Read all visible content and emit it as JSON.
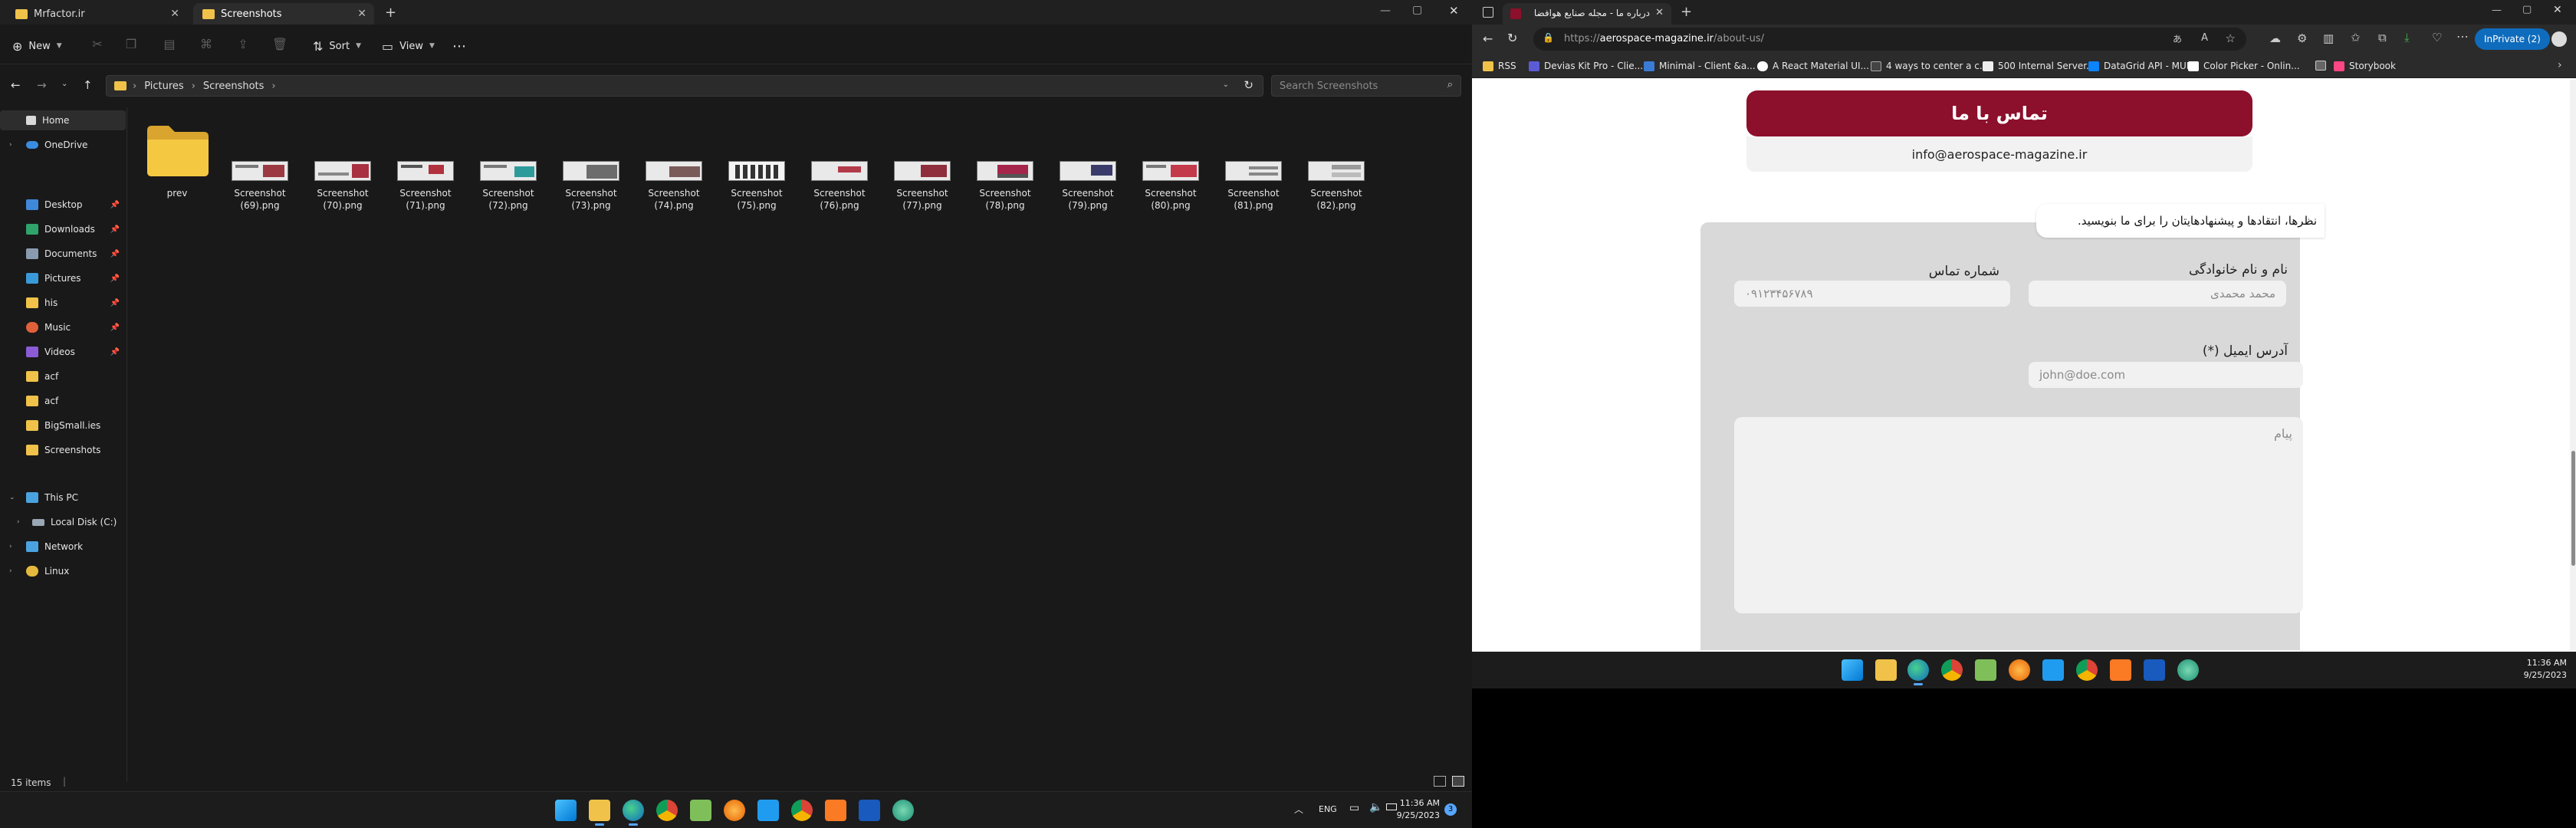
{
  "explorer": {
    "tabs": [
      {
        "label": "Mrfactor.ir"
      },
      {
        "label": "Screenshots"
      }
    ],
    "toolbar": {
      "new_label": "New",
      "sort_label": "Sort",
      "view_label": "View"
    },
    "breadcrumb": [
      "Pictures",
      "Screenshots"
    ],
    "search_placeholder": "Search Screenshots",
    "nav": {
      "home": "Home",
      "onedrive": "OneDrive",
      "quick": [
        "Desktop",
        "Downloads",
        "Documents",
        "Pictures",
        "his",
        "Music",
        "Videos",
        "acf",
        "acf",
        "BigSmall.ies",
        "Screenshots"
      ],
      "thispc": "This PC",
      "localdisk": "Local Disk (C:)",
      "network": "Network",
      "linux": "Linux"
    },
    "files": [
      {
        "l1": "prev",
        "l2": ""
      },
      {
        "l1": "Screenshot",
        "l2": "(69).png"
      },
      {
        "l1": "Screenshot",
        "l2": "(70).png"
      },
      {
        "l1": "Screenshot",
        "l2": "(71).png"
      },
      {
        "l1": "Screenshot",
        "l2": "(72).png"
      },
      {
        "l1": "Screenshot",
        "l2": "(73).png"
      },
      {
        "l1": "Screenshot",
        "l2": "(74).png"
      },
      {
        "l1": "Screenshot",
        "l2": "(75).png"
      },
      {
        "l1": "Screenshot",
        "l2": "(76).png"
      },
      {
        "l1": "Screenshot",
        "l2": "(77).png"
      },
      {
        "l1": "Screenshot",
        "l2": "(78).png"
      },
      {
        "l1": "Screenshot",
        "l2": "(79).png"
      },
      {
        "l1": "Screenshot",
        "l2": "(80).png"
      },
      {
        "l1": "Screenshot",
        "l2": "(81).png"
      },
      {
        "l1": "Screenshot",
        "l2": "(82).png"
      }
    ],
    "status": "15 items"
  },
  "edge": {
    "tab_title": "درباره ما - مجله صنایع هوافضا",
    "url_prefix": "https://",
    "url_host": "aerospace-magazine.ir",
    "url_path": "/about-us/",
    "inprivate": "InPrivate (2)",
    "favorites": [
      "RSS",
      "Devias Kit Pro - Clie...",
      "Minimal - Client &a...",
      "A React Material UI...",
      "4 ways to center a c...",
      "500 Internal Server...",
      "DataGrid API - MUI X",
      "Color Picker - Onlin...",
      "Storybook"
    ]
  },
  "webpage": {
    "contact_button": "تماس با ما",
    "email": "info@aerospace-magazine.ir",
    "intro": "نظرها، انتقادها و پیشنهادهایتان را برای ما بنویسید.",
    "name_label": "نام و نام خانوادگی",
    "name_placeholder": "محمد محمدی",
    "phone_label": "شماره تماس",
    "phone_placeholder": "۰۹۱۲۳۴۵۶۷۸۹",
    "email_label": "آدرس ایمیل (*)",
    "email_placeholder": "john@doe.com",
    "message_placeholder": "پیام"
  },
  "right_clock": {
    "time": "11:36 AM",
    "date": "9/25/2023"
  },
  "main_taskbar": {
    "lang": "ENG",
    "time": "11:36 AM",
    "date": "9/25/2023",
    "notif_count": "3"
  },
  "colors": {
    "accent": "#8c0f2b",
    "form_bg": "#d9d9d9",
    "edge_blue": "#0f6cbd",
    "folder": "#f0c24a"
  }
}
